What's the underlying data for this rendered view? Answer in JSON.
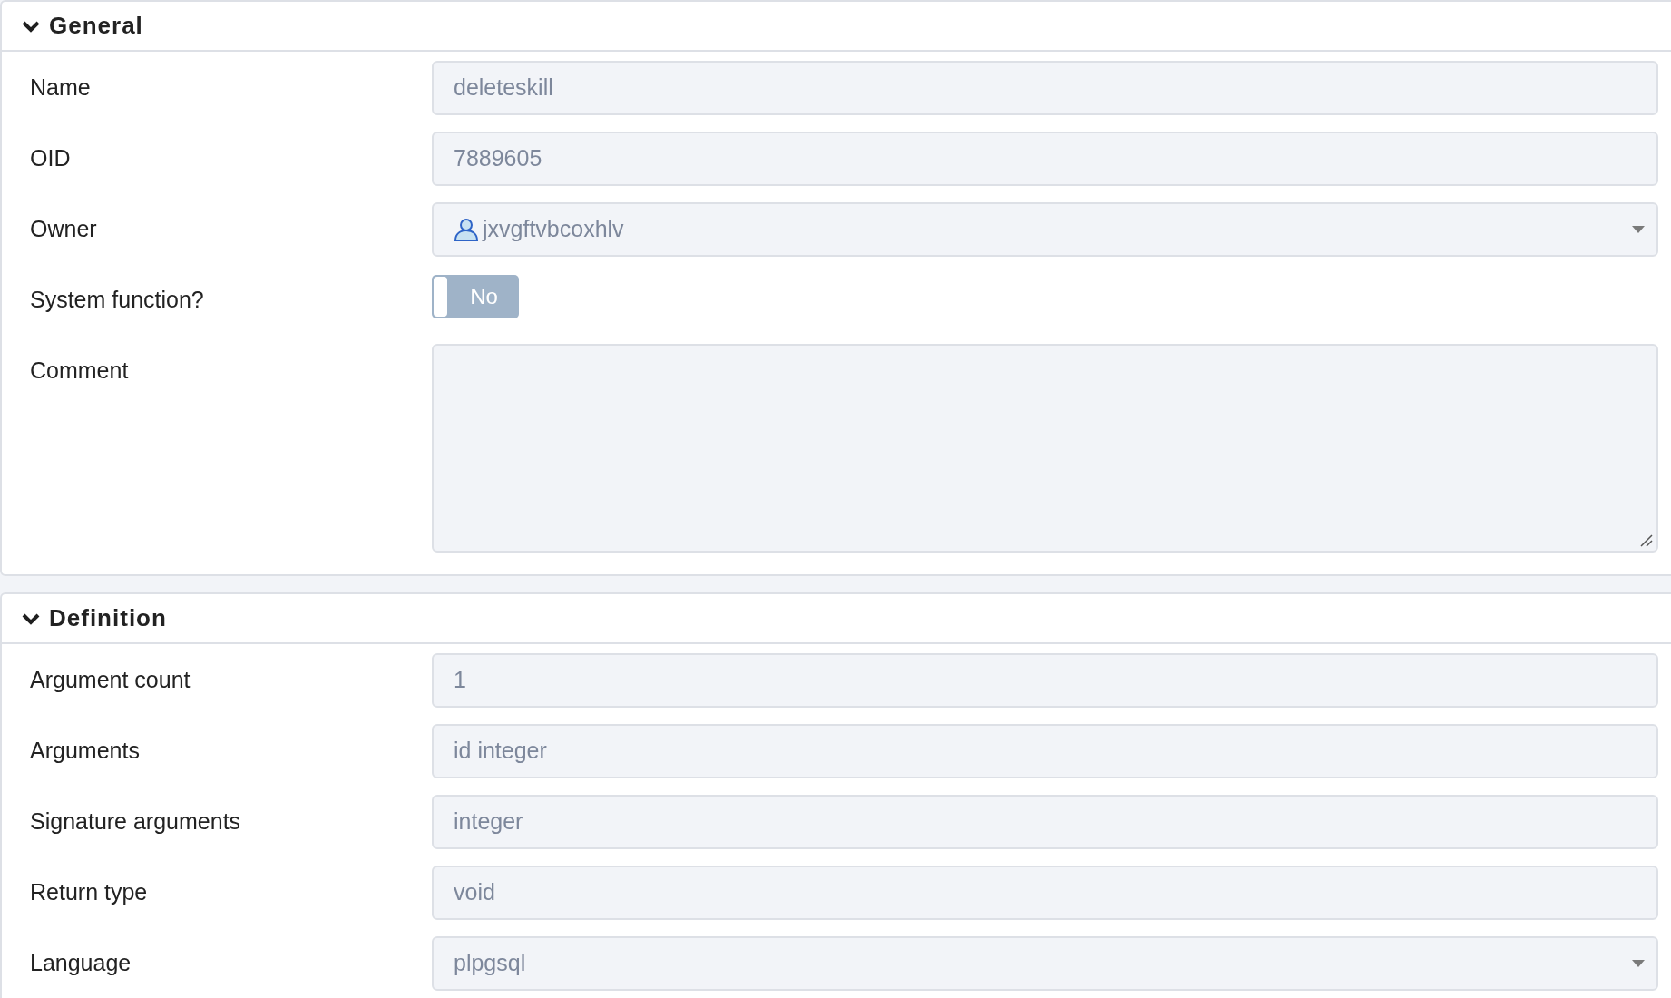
{
  "sections": [
    {
      "title": "General",
      "expanded": true,
      "fields": [
        {
          "kind": "text",
          "label": "Name",
          "value": "deleteskill"
        },
        {
          "kind": "text",
          "label": "OID",
          "value": "7889605"
        },
        {
          "kind": "user-select",
          "label": "Owner",
          "value": "jxvgftvbcoxhlv"
        },
        {
          "kind": "toggle",
          "label": "System function?",
          "on": false,
          "text": "No"
        },
        {
          "kind": "textarea",
          "label": "Comment"
        }
      ]
    },
    {
      "title": "Definition",
      "expanded": true,
      "fields": [
        {
          "kind": "text",
          "label": "Argument count",
          "value": "1"
        },
        {
          "kind": "text",
          "label": "Arguments",
          "value": "id integer"
        },
        {
          "kind": "text",
          "label": "Signature arguments",
          "value": "integer"
        },
        {
          "kind": "text",
          "label": "Return type",
          "value": "void"
        },
        {
          "kind": "select",
          "label": "Language",
          "value": "plpgsql"
        }
      ]
    }
  ]
}
